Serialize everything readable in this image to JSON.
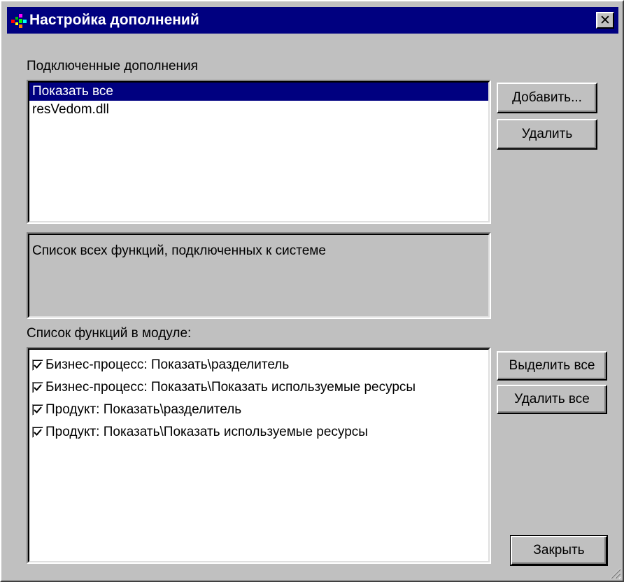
{
  "window": {
    "title": "Настройка дополнений",
    "close_glyph": "✕"
  },
  "plugins": {
    "label": "Подключенные дополнения",
    "items": [
      "Показать все",
      "resVedom.dll"
    ],
    "selected_index": 0
  },
  "description": {
    "text": "Список всех функций, подключенных к системе"
  },
  "functions": {
    "label": "Список функций в модуле:",
    "items": [
      {
        "text": "Бизнес-процесс: Показать\\разделитель",
        "checked": true
      },
      {
        "text": "Бизнес-процесс: Показать\\Показать используемые ресурсы",
        "checked": true
      },
      {
        "text": "Продукт: Показать\\разделитель",
        "checked": true
      },
      {
        "text": "Продукт: Показать\\Показать используемые ресурсы",
        "checked": true
      }
    ]
  },
  "buttons": {
    "add": "Добавить...",
    "remove": "Удалить",
    "select_all": "Выделить все",
    "remove_all": "Удалить все",
    "close": "Закрыть"
  },
  "colors": {
    "titlebar": "#000080",
    "face": "#c0c0c0",
    "selection": "#000080"
  },
  "icons": {
    "app": "app-icon",
    "close": "close-icon",
    "check": "checkmark-icon",
    "grip": "resize-grip-icon"
  }
}
